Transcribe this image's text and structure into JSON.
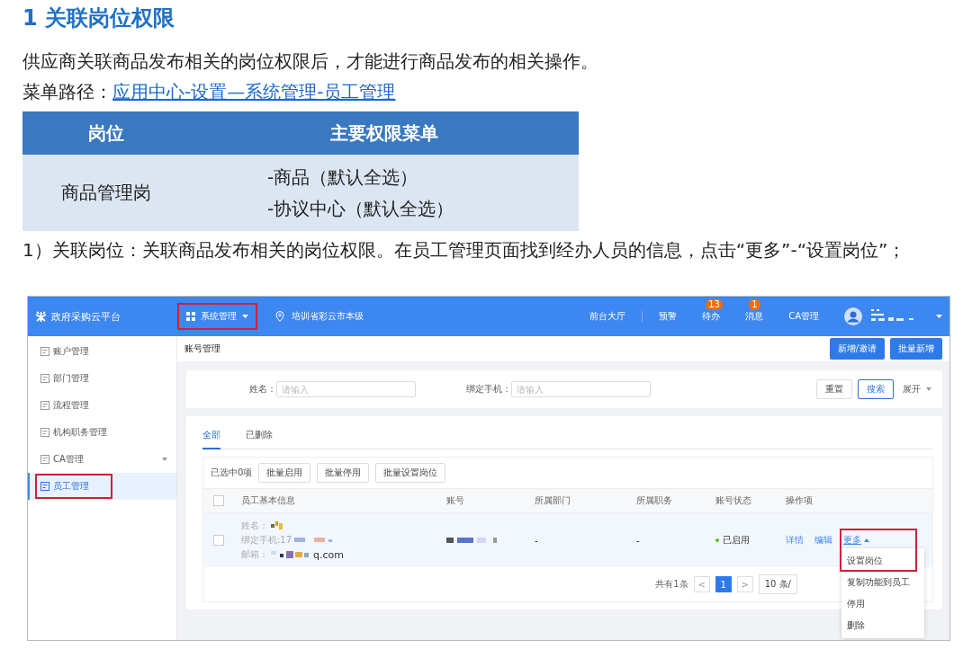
{
  "heading": "1 关联岗位权限",
  "intro": "供应商关联商品发布相关的岗位权限后，才能进行商品发布的相关操作。",
  "menu_path": {
    "label": "菜单路径：",
    "link": "应用中心-设置—系统管理-员工管理"
  },
  "role_table": {
    "columns": [
      "岗位",
      "主要权限菜单"
    ],
    "rows": [
      {
        "role": "商品管理岗",
        "permissions": [
          "-商品（默认全选）",
          "-协议中心（默认全选）"
        ]
      }
    ]
  },
  "step": "1）关联岗位：关联商品发布相关的岗位权限。在员工管理页面找到经办人员的信息，点击“更多”-“设置岗位”；",
  "app": {
    "brand": "政府采购云平台",
    "system_menu": {
      "label": "系统管理",
      "highlighted": true
    },
    "location": "培训省彩云市本级",
    "nav": [
      {
        "label": "前台大厅"
      },
      {
        "label": "预警"
      },
      {
        "label": "待办",
        "badge": "13"
      },
      {
        "label": "消息",
        "badge": "1"
      },
      {
        "label": "CA管理"
      }
    ],
    "sidebar": [
      {
        "label": "账户管理",
        "selected": false,
        "highlighted": false,
        "expandable": false
      },
      {
        "label": "部门管理",
        "selected": false,
        "highlighted": false,
        "expandable": false
      },
      {
        "label": "流程管理",
        "selected": false,
        "highlighted": false,
        "expandable": false
      },
      {
        "label": "机构职务管理",
        "selected": false,
        "highlighted": false,
        "expandable": false
      },
      {
        "label": "CA管理",
        "selected": false,
        "highlighted": false,
        "expandable": true
      },
      {
        "label": "员工管理",
        "selected": true,
        "highlighted": true,
        "expandable": false
      }
    ],
    "page_title": "账号管理",
    "header_buttons": [
      "新增/邀请",
      "批量新增"
    ],
    "filters": [
      {
        "label": "姓名：",
        "placeholder": "请输入"
      },
      {
        "label": "绑定手机：",
        "placeholder": "请输入"
      }
    ],
    "reset_button": "重置",
    "search_button": "搜索",
    "expand_toggle": "展开",
    "tabs": [
      {
        "label": "全部",
        "selected": true
      },
      {
        "label": "已删除",
        "selected": false
      }
    ],
    "selected_count": "已选中0项",
    "batch_buttons": [
      "批量启用",
      "批量停用",
      "批量设置岗位"
    ],
    "select_all": {
      "checked": false
    },
    "columns": [
      "员工基本信息",
      "账号",
      "所属部门",
      "所属职务",
      "账号状态",
      "操作项"
    ],
    "rows": [
      {
        "checked": false,
        "info": [
          "姓名：",
          "绑定手机:17",
          "邮箱："
        ],
        "email_tail": "q.com",
        "department": "-",
        "duty": "-",
        "status": {
          "label": "已启用",
          "color": "#52c41a"
        },
        "actions": [
          "详情",
          "编辑"
        ],
        "more": {
          "label": "更多",
          "highlighted": true
        }
      }
    ],
    "more_menu": [
      "设置岗位",
      "复制功能到员工",
      "停用",
      "删除"
    ],
    "pagination": {
      "total": "共有1条",
      "prev": "<",
      "pages": [
        {
          "label": "1",
          "selected": true
        }
      ],
      "next": ">",
      "page_size": "10 条/"
    }
  }
}
